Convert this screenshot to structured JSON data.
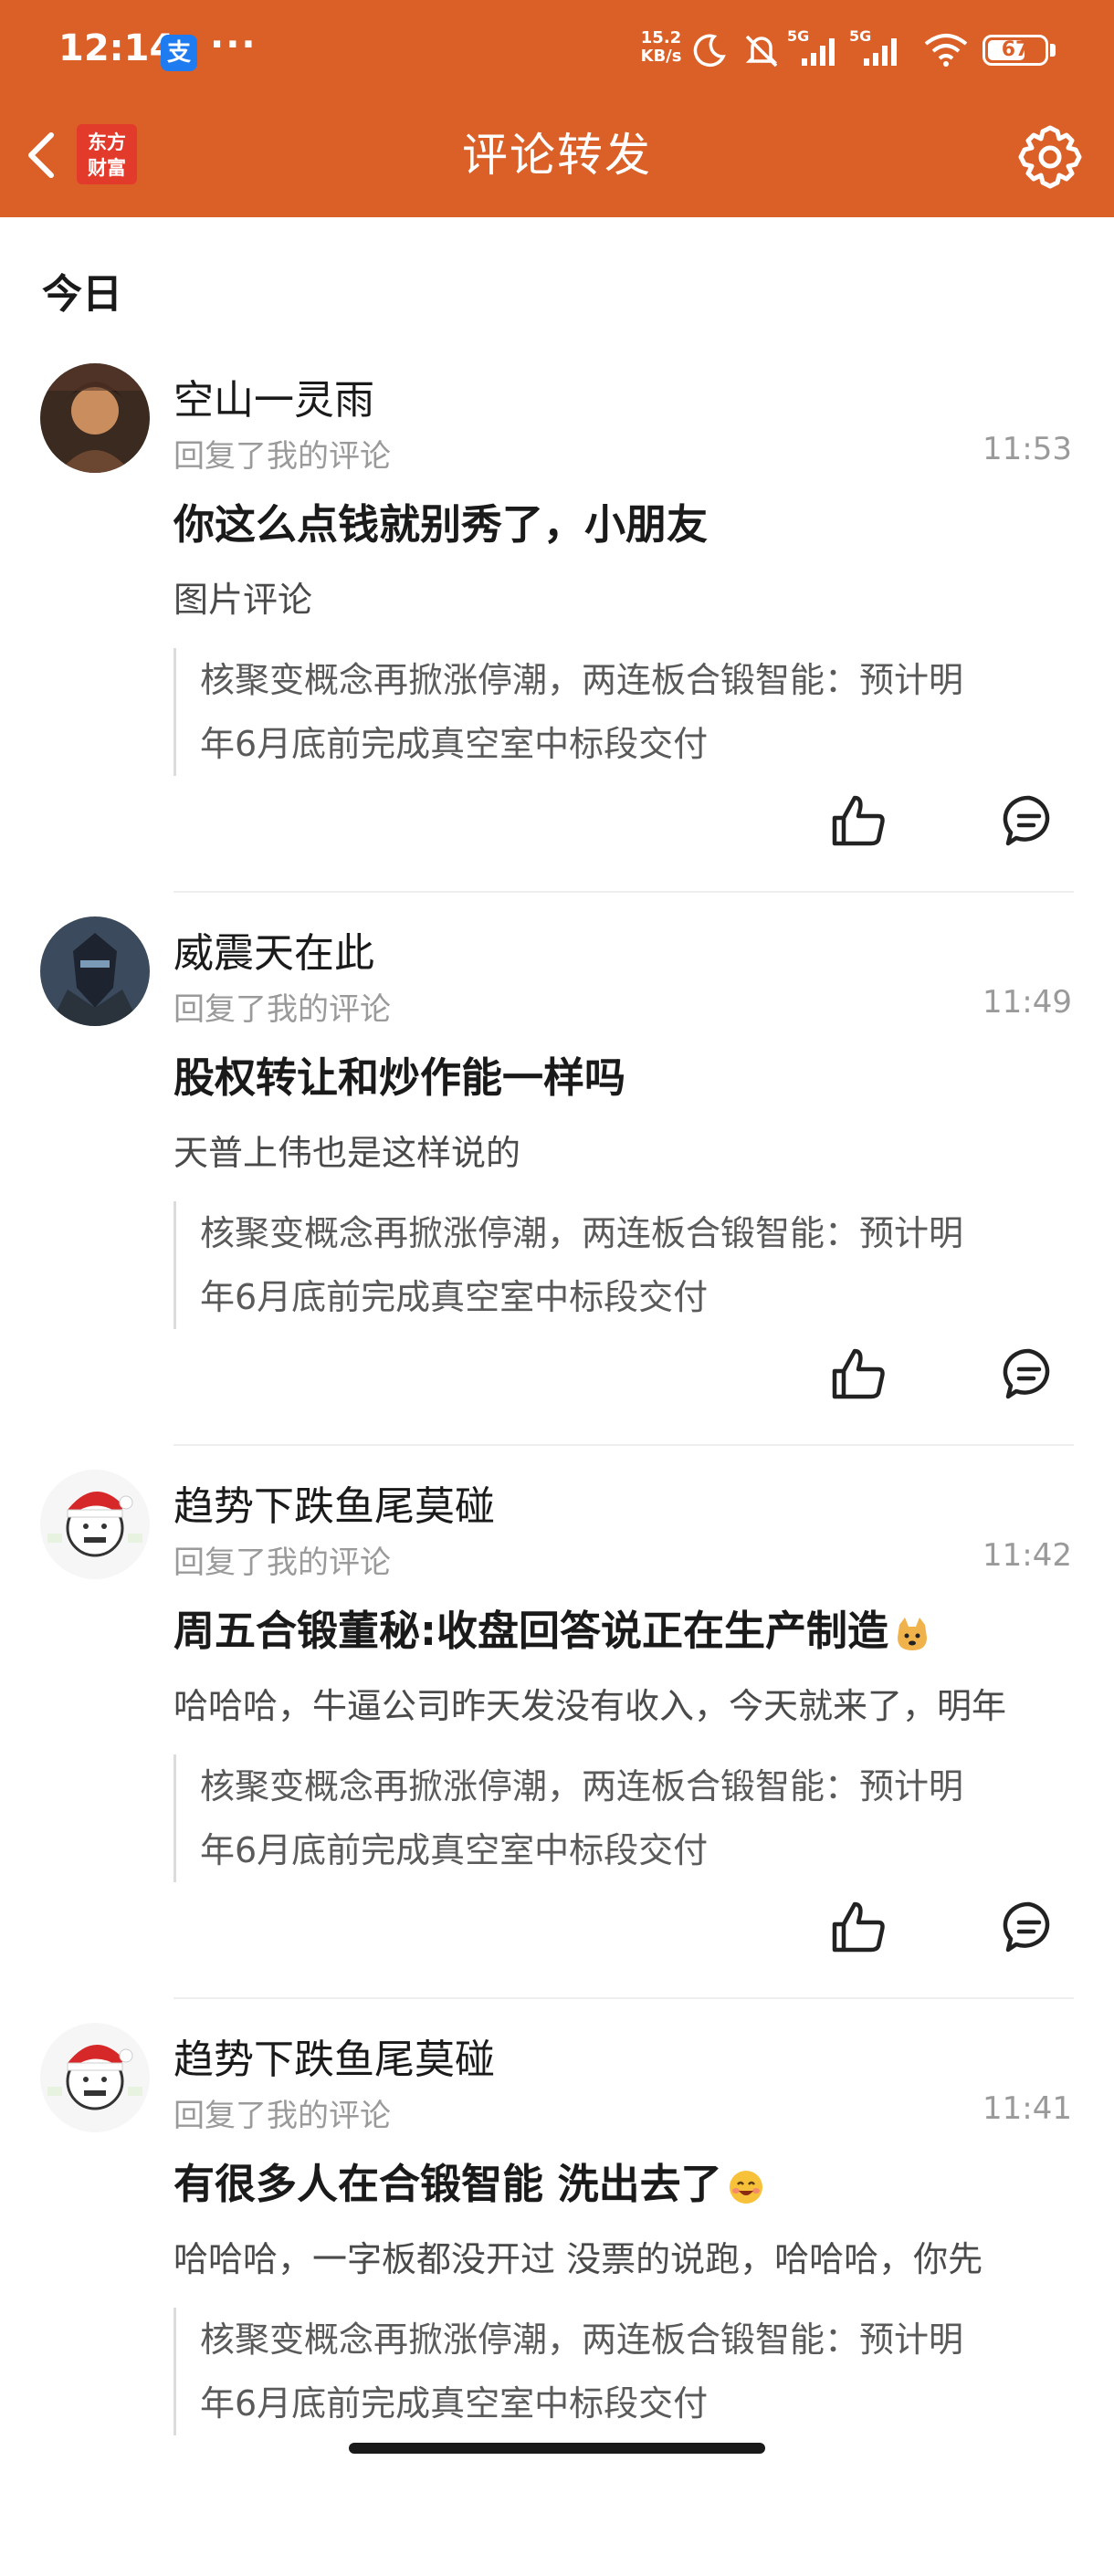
{
  "status_bar": {
    "time": "12:14",
    "alipay_badge": "支",
    "dots": "···",
    "net_speed_value": "15.2",
    "net_speed_unit": "KB/s",
    "signal_1": "5G",
    "signal_2": "5G",
    "battery": "67"
  },
  "header": {
    "title": "评论转发",
    "logo_line1": "东方",
    "logo_line2": "财富"
  },
  "section_label": "今日",
  "comments": [
    {
      "username": "空山一灵雨",
      "reply_label": "回复了我的评论",
      "time": "11:53",
      "text": "你这么点钱就别秀了，小朋友",
      "sub_text": "图片评论",
      "quote_line1": "核聚变概念再掀涨停潮，两连板合锻智能：预计明",
      "quote_line2": "年6月底前完成真空室中标段交付"
    },
    {
      "username": "威震天在此",
      "reply_label": "回复了我的评论",
      "time": "11:49",
      "text": "股权转让和炒作能一样吗",
      "sub_text": "天普上伟也是这样说的",
      "quote_line1": "核聚变概念再掀涨停潮，两连板合锻智能：预计明",
      "quote_line2": "年6月底前完成真空室中标段交付"
    },
    {
      "username": "趋势下跌鱼尾莫碰",
      "reply_label": "回复了我的评论",
      "time": "11:42",
      "text": "周五合锻董秘:收盘回答说正在生产制造",
      "sub_text": "哈哈哈，牛逼公司昨天发没有收入，今天就来了，明年",
      "quote_line1": "核聚变概念再掀涨停潮，两连板合锻智能：预计明",
      "quote_line2": "年6月底前完成真空室中标段交付"
    },
    {
      "username": "趋势下跌鱼尾莫碰",
      "reply_label": "回复了我的评论",
      "time": "11:41",
      "text": "有很多人在合锻智能 洗出去了",
      "sub_text": "哈哈哈，一字板都没开过  没票的说跑，哈哈哈，你先",
      "quote_line1": "核聚变概念再掀涨停潮，两连板合锻智能：预计明",
      "quote_line2": "年6月底前完成真空室中标段交付"
    }
  ],
  "colors": {
    "header_bg": "#db6028",
    "text_primary": "#1a1a1a",
    "text_secondary": "#9a9a9a"
  }
}
